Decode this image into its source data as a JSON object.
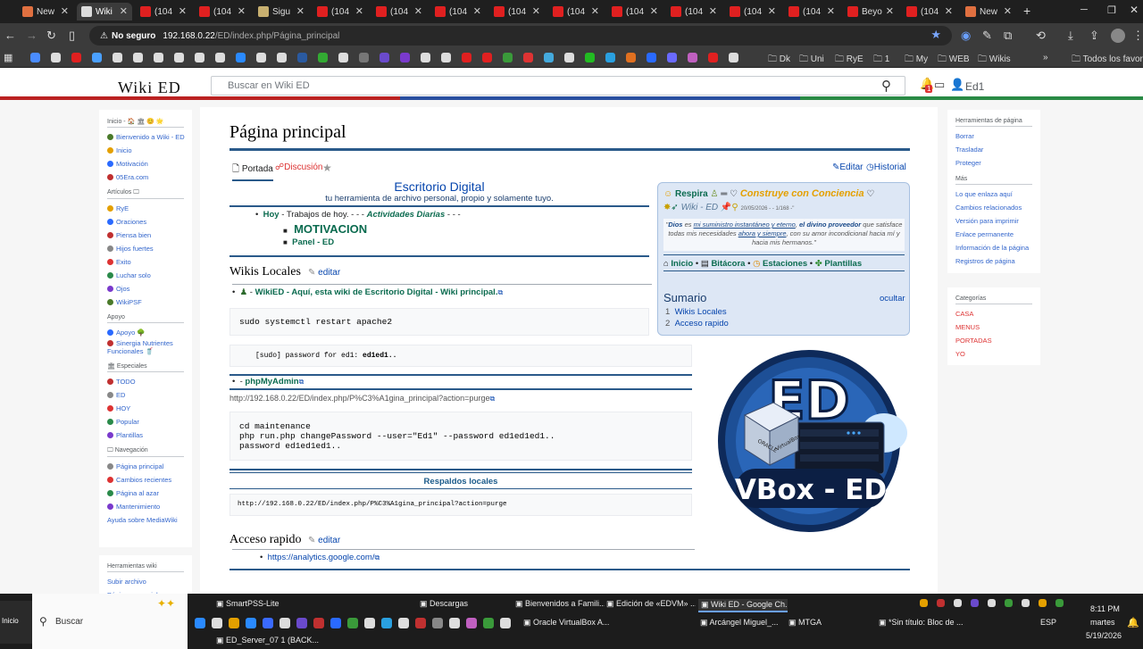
{
  "browser": {
    "tabs": [
      {
        "label": "New",
        "color": "#e07040"
      },
      {
        "label": "Wiki",
        "color": "#dddddd"
      },
      {
        "label": "(104",
        "color": "#e02020"
      },
      {
        "label": "(104",
        "color": "#e02020"
      },
      {
        "label": "Sigu",
        "color": "#c8b070"
      },
      {
        "label": "(104",
        "color": "#e02020"
      },
      {
        "label": "(104",
        "color": "#e02020"
      },
      {
        "label": "(104",
        "color": "#e02020"
      },
      {
        "label": "(104",
        "color": "#e02020"
      },
      {
        "label": "(104",
        "color": "#e02020"
      },
      {
        "label": "(104",
        "color": "#e02020"
      },
      {
        "label": "(104",
        "color": "#e02020"
      },
      {
        "label": "(104",
        "color": "#e02020"
      },
      {
        "label": "(104",
        "color": "#e02020"
      },
      {
        "label": "Beyo",
        "color": "#e02020"
      },
      {
        "label": "(104",
        "color": "#e02020"
      },
      {
        "label": "New",
        "color": "#e07040"
      }
    ],
    "new_tab": "+",
    "security_label": "No seguro",
    "url_host": "192.168.0.22",
    "url_path": "/ED/index.php/Página_principal",
    "bookmark_folders": [
      "Dk",
      "Uni",
      "RyE",
      "1",
      "My",
      "WEB",
      "Wikis"
    ],
    "bookmarks_more": "»",
    "all_bookmarks": "Todos los favoritos"
  },
  "wiki": {
    "logo": "Wiki ED",
    "search_placeholder": "Buscar en Wiki ED",
    "notif_count": "1",
    "user": "Ed1"
  },
  "left_sidebar": {
    "sections": [
      {
        "heading": "Inicio - 🏠 🏛 😊 🌟",
        "items": [
          "Bienvenido a Wiki - ED",
          "Inicio",
          "Motivación",
          "05Era.com"
        ]
      },
      {
        "heading": "Artículos 🖵",
        "items": [
          "RyE",
          "Oraciones",
          "Piensa bien",
          "Hijos fuertes",
          "Exito",
          "Luchar solo",
          "Ojos",
          "WikiPSF"
        ]
      },
      {
        "heading": "Apoyo",
        "items": [
          "Apoyo 🌳",
          "Sinergia Nutrientes Funcionales 🥤"
        ]
      },
      {
        "heading": "🏛 Especiales",
        "items": [
          "TODO",
          "ED",
          "HOY",
          "Popular",
          "Plantillas"
        ]
      },
      {
        "heading": "🖵 Navegación",
        "items": [
          "Página principal",
          "Cambios recientes",
          "Página al azar",
          "Mantenimiento",
          "Ayuda sobre MediaWiki"
        ]
      },
      {
        "heading": "Herramientas wiki",
        "items": [
          "Subir archivo",
          "Páginas especiales"
        ]
      }
    ]
  },
  "right_sidebar": {
    "tools_heading": "Herramientas de página",
    "tools": [
      "Borrar",
      "Trasladar",
      "Proteger"
    ],
    "more_heading": "Más",
    "more": [
      "Lo que enlaza aquí",
      "Cambios relacionados",
      "Versión para imprimir",
      "Enlace permanente",
      "Información de la página",
      "Registros de página"
    ],
    "cat_heading": "Categorías",
    "categories": [
      "CASA",
      "MENUS",
      "PORTADAS",
      "YO"
    ]
  },
  "page": {
    "title": "Página principal",
    "tab_portada": "Portada",
    "tab_discusion": "Discusión",
    "action_edit": "Editar",
    "action_history": "Historial",
    "escritorio_title": "Escritorio Digital",
    "escritorio_sub": "tu herramienta de archivo personal, propio y solamente tuyo.",
    "hoy_link": "Hoy",
    "hoy_text": " - Trabajos de hoy. - - - ",
    "actividades": "Actividades Diarias",
    "actividades_tail": " - - -",
    "motivacion": "MOTIVACION",
    "panel_ed": "Panel - ED",
    "wikis_heading": "Wikis Locales",
    "edit_link": "editar",
    "wikied_link": "WikiED - Aquí, esta wiki de Escritorio Digital - Wiki principal.",
    "code1": "sudo systemctl restart apache2",
    "code2_prefix": "[sudo] password for ed1: ",
    "code2_pw": "ed1ed1..",
    "phpmyadmin": "phpMyAdmin",
    "purge_url": "http://192.168.0.22/ED/index.php/P%C3%A1gina_principal?action=purge",
    "code3_l1": "cd maintenance",
    "code3_l2": "php run.php changePassword --user=\"Ed1\" --password ed1ed1ed1..",
    "code3_l3": "password ed1ed1ed1..",
    "respaldos": "Respaldos locales",
    "code4": "http://192.168.0.22/ED/index.php/P%C3%A1gina_principal?action=purge",
    "acceso_heading": "Acceso rapido",
    "analytics": "https://analytics.google.com/"
  },
  "infobox": {
    "respira": "Respira",
    "construye": "Construye con Conciencia",
    "wiki_ed": "Wiki - ED",
    "date_info": "20/05/2026 - - 1/168 -\"",
    "quote_dios": "Dios",
    "quote_es": " es ",
    "quote_l1": "mi suministro instantáneo y eterno",
    "quote_comma": ", ",
    "quote_div": "el divino proveedor",
    "quote_que": " que satisface todas mis necesidades ",
    "quote_ahora": "ahora y siempre",
    "quote_tail": ", con su amor incondicional hacia mí y hacia mis hermanos.\"",
    "nav_inicio": "Inicio",
    "nav_bitacora": "Bitácora",
    "nav_estaciones": "Estaciones",
    "nav_plantillas": "Plantillas",
    "toc_title": "Sumario",
    "toc_hide": "ocultar",
    "toc_1_num": "1",
    "toc_1": "Wikis Locales",
    "toc_2_num": "2",
    "toc_2": "Acceso rapido"
  },
  "logo_badge": {
    "top": "ED",
    "bottom": "VBox - ED",
    "box_label": "VirtualBox",
    "oracle": "ORACLE"
  },
  "taskbar": {
    "start": "Inicio",
    "search": "Buscar",
    "apps_row1": [
      "SmartPSS-Lite",
      "Descargas",
      "Bienvenidos a Famili...",
      "Edición de «EDVM» ...",
      "Wiki ED - Google Ch..."
    ],
    "apps_row2": [
      "Oracle VirtualBox A...",
      "Arcángel Miguel_...",
      "MTGA",
      "*Sin título: Bloc de ..."
    ],
    "apps_row3": [
      "ED_Server_07 1 (BACK..."
    ],
    "lang": "ESP",
    "time": "8:11 PM",
    "day": "martes",
    "date": "5/19/2026"
  }
}
